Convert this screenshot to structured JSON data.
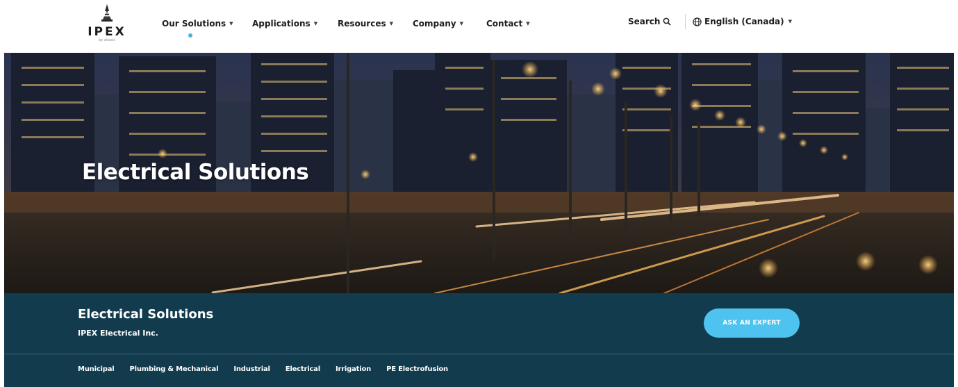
{
  "header": {
    "logo_text": "IPEX",
    "logo_tagline": "by aliaxis",
    "nav": [
      {
        "label": "Our Solutions"
      },
      {
        "label": "Applications"
      },
      {
        "label": "Resources"
      },
      {
        "label": "Company"
      },
      {
        "label": "Contact"
      }
    ],
    "search_label": "Search",
    "language_label": "English (Canada)"
  },
  "hero": {
    "title": "Electrical Solutions"
  },
  "band": {
    "title": "Electrical Solutions",
    "subtitle": "IPEX Electrical Inc.",
    "cta_label": "ASK AN EXPERT",
    "tabs": [
      {
        "label": "Municipal"
      },
      {
        "label": "Plumbing & Mechanical"
      },
      {
        "label": "Industrial"
      },
      {
        "label": "Electrical"
      },
      {
        "label": "Irrigation"
      },
      {
        "label": "PE Electrofusion"
      }
    ]
  },
  "colors": {
    "accent": "#4fc3f0",
    "band_background": "#123c4d",
    "active_dot": "#45b3e6"
  },
  "icons": {
    "search": "search-icon",
    "language": "globe-icon",
    "dropdown": "chevron-down-icon"
  }
}
